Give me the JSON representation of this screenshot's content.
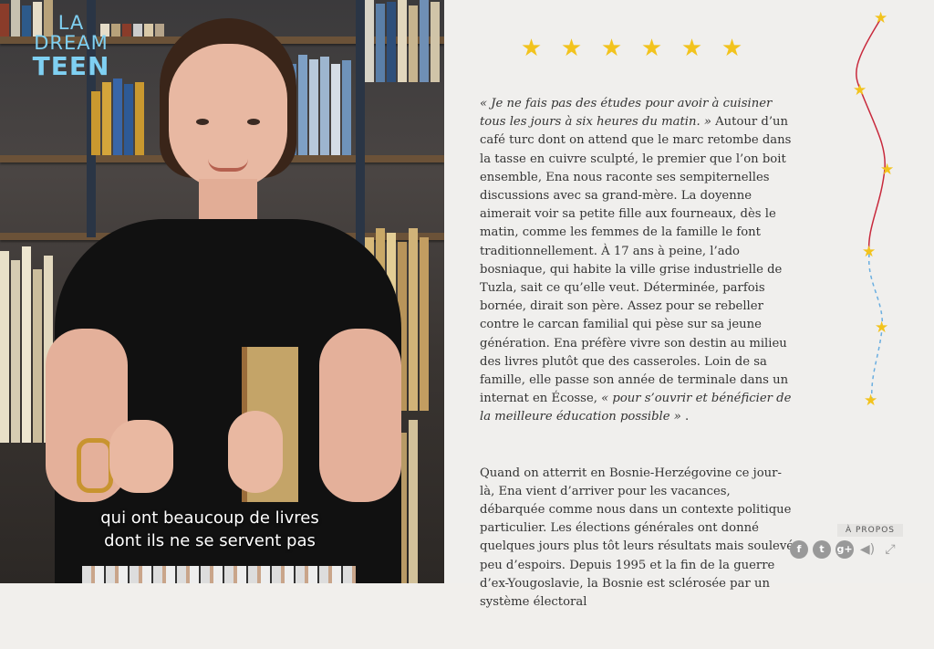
{
  "logo": {
    "line1": "LA",
    "line2": "DREAM",
    "line3": "TEEN"
  },
  "video": {
    "subtitle_line1": "qui ont beaucoup de livres",
    "subtitle_line2": "dont ils ne se servent pas"
  },
  "rating": {
    "stars": 6
  },
  "article": {
    "p1_quote": "« Je ne fais pas des études pour avoir à cuisiner tous les jours à six heures du matin. »",
    "p1_body": " Autour d’un café turc dont on attend que le marc retombe dans la tasse en cuivre sculpté, le premier que l’on boit ensemble, Ena nous raconte ses sempiternelles discussions avec sa grand-mère. La doyenne aimerait voir sa petite fille aux fourneaux, dès le matin, comme les femmes de la famille le font traditionnellement. À 17 ans à peine, l’ado bosniaque, qui habite la ville grise industrielle de Tuzla, sait ce qu’elle veut. Déterminée, parfois bornée, dirait son père. Assez pour se rebeller contre le carcan familial qui pèse sur sa jeune génération. Ena préfère vivre son destin au milieu des livres plutôt que des casseroles. Loin de sa famille, elle passe son année de terminale dans un internat en Écosse, ",
    "p1_quote2": "« pour s’ouvrir et bénéficier de la meilleure éducation possible »",
    "p1_end": " .",
    "p2": "Quand on atterrit en Bosnie-Herzégovine ce jour-là, Ena vient d’arriver pour les vacances, débarquée comme nous dans un contexte politique particulier. Les élections générales ont donné quelques jours plus tôt leurs résultats mais soulevé peu d’espoirs. Depuis 1995 et la fin de la guerre d’ex-Yougoslavie, la Bosnie est sclérosée par un système électoral"
  },
  "footer": {
    "apropos": "À PROPOS",
    "icons": [
      "facebook-icon",
      "twitter-icon",
      "google-plus-icon",
      "sound-icon",
      "fullscreen-icon"
    ]
  },
  "colors": {
    "star": "#f2c31d",
    "timeline_red": "#c8293c",
    "timeline_blue": "#6aaee0",
    "logo": "#7fd0f2"
  }
}
